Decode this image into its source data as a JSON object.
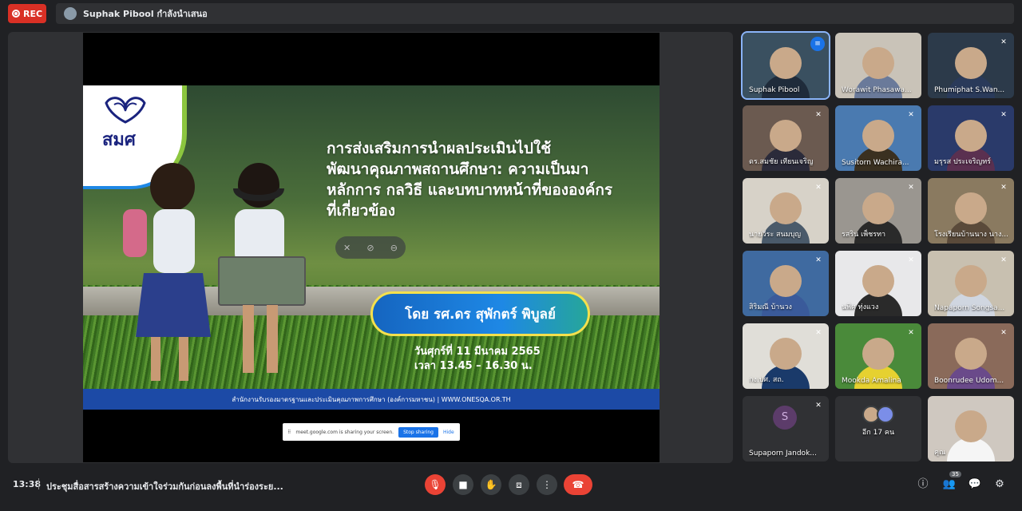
{
  "topbar": {
    "rec_label": "REC",
    "presenter_text": "Suphak Pibool กำลังนำเสนอ"
  },
  "slide": {
    "logo_text": "สมศ",
    "title_line1": "การส่งเสริมการนำผลประเมินไปใช้",
    "title_line2_a": "พัฒนาคุณภาพสถานศึกษา: ",
    "title_line2_b": "ความเป็นมา",
    "title_line3": "หลักการ กลวิธี และบทบาทหน้าที่ขององค์กร",
    "title_line4": "ที่เกี่ยวข้อง",
    "speaker": "โดย รศ.ดร สุพักตร์ พิบูลย์",
    "date_line1": "วันศุกร์ที่ 11 มีนาคม 2565",
    "date_line2": "เวลา 13.45 – 16.30 น.",
    "footer": "สำนักงานรับรองมาตรฐานและประเมินคุณภาพการศึกษา (องค์การมหาชน) | WWW.ONESQA.OR.TH"
  },
  "share_banner": {
    "text": "meet.google.com is sharing your screen.",
    "stop_label": "Stop sharing",
    "hide_label": "Hide"
  },
  "participants": [
    {
      "name": "Suphak Pibool",
      "muted": false,
      "speaking": true
    },
    {
      "name": "Worawit Phasawa...",
      "muted": false
    },
    {
      "name": "Phumiphat S.Wan...",
      "muted": true
    },
    {
      "name": "ดร.สมชัย เทียนเจริญ",
      "muted": true
    },
    {
      "name": "Susitorn Wachira...",
      "muted": true
    },
    {
      "name": "มรุรส ประเจริญทร์",
      "muted": true
    },
    {
      "name": "นายวีระ สนมบุญ",
      "muted": true
    },
    {
      "name": "รสริน เพ็ชรทา",
      "muted": true
    },
    {
      "name": "โรงเรียนบ้านนาง นาง...",
      "muted": true
    },
    {
      "name": "สิริมณี บ้านวง",
      "muted": true
    },
    {
      "name": "นพิศ ทุ่งแวง",
      "muted": true
    },
    {
      "name": "Napaporn Songsa...",
      "muted": true
    },
    {
      "name": "กง.ปศ. สถ.",
      "muted": true
    },
    {
      "name": "Mookda Amalina",
      "muted": true
    },
    {
      "name": "Boonrudee Udom...",
      "muted": true
    },
    {
      "name": "Supaporn Jandok...",
      "muted": true,
      "initial": "S"
    },
    {
      "name": "อีก 17 คน",
      "muted": false
    },
    {
      "name": "คุณ",
      "muted": false
    }
  ],
  "bottombar": {
    "time": "13:38",
    "meeting_title": "ประชุมสื่อสารสร้างความเข้าใจร่วมกันก่อนลงพื้นที่นำร่องระย...",
    "people_count": "35"
  },
  "colors": {
    "background": "#202124",
    "hangup": "#ea4335",
    "accent": "#1a73e8"
  }
}
